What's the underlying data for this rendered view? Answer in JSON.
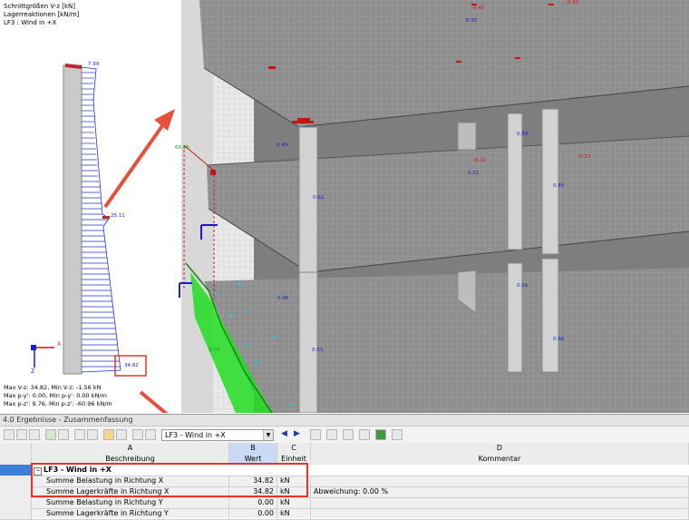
{
  "viewport": {
    "header": {
      "line1": "Schnittgrößen V-z [kN]",
      "line2": "Lagerreaktionen [kN/m]",
      "line3": "LF3 : Wind in +X"
    },
    "column_labels": {
      "top": "7.99",
      "middle": "25.11",
      "bottom": "34.82"
    },
    "axis_labels": {
      "x": "X",
      "z": "Z"
    },
    "summary": {
      "line1": "Max V-z: 34.82, Min V-z: -1.56 kN",
      "line2": "Max p-y': 0.00, Min p-y': 0.00 kN/m",
      "line3": "Max p-z': 9.76, Min p-z': -60.96 kN/m"
    },
    "model_values": {
      "v035": "0.35",
      "vm023": "-0.23",
      "vm042": "-0.42",
      "v049": "0.49",
      "v069": "0.69",
      "vm021": "-0.21",
      "v021": "0.21",
      "v062": "0.62",
      "v085": "0.85",
      "v046": "0.46",
      "v056": "0.56",
      "v063": "0.63",
      "v066": "0.66",
      "v976": "9.76",
      "v6096": "60.96"
    }
  },
  "panel": {
    "title": "4.0 Ergebnisse - Zusammenfassung",
    "loadcase_select": "LF3 - Wind in +X",
    "columns": {
      "letters": [
        "A",
        "B",
        "C",
        "D"
      ],
      "headers": [
        "Beschreibung",
        "Wert",
        "Einheit",
        "Kommentar"
      ]
    },
    "group": "LF3 - Wind in +X",
    "rows": [
      {
        "desc": "Summe Belastung in Richtung X",
        "value": "34.82",
        "unit": "kN",
        "comment": ""
      },
      {
        "desc": "Summe Lagerkräfte in Richtung X",
        "value": "34.82",
        "unit": "kN",
        "comment": "Abweichung:  0.00 %"
      },
      {
        "desc": "Summe Belastung in Richtung Y",
        "value": "0.00",
        "unit": "kN",
        "comment": ""
      },
      {
        "desc": "Summe Lagerkräfte in Richtung Y",
        "value": "0.00",
        "unit": "kN",
        "comment": ""
      }
    ]
  },
  "colors": {
    "highlight_red": "#e0362b",
    "arrow_red": "#e8503c",
    "diagram_blue": "#2233cc",
    "support_green": "#22dd22",
    "selected_row": "#3b7fd8"
  }
}
